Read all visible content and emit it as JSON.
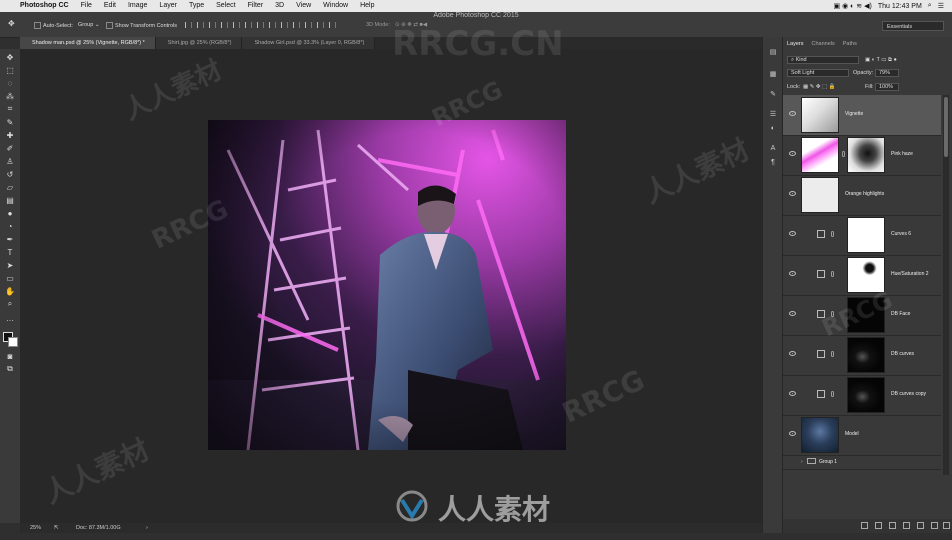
{
  "menubar": {
    "app_name": "Photoshop CC",
    "items": [
      "File",
      "Edit",
      "Image",
      "Layer",
      "Type",
      "Select",
      "Filter",
      "3D",
      "View",
      "Window",
      "Help"
    ],
    "clock": "Thu 12:43 PM"
  },
  "window_title": "Adobe Photoshop CC 2015",
  "options_bar": {
    "auto_select_label": "Auto-Select:",
    "auto_select_target": "Group",
    "show_transform_label": "Show Transform Controls",
    "mode_3d_label": "3D Mode:",
    "workspace": "Essentials"
  },
  "tabs": [
    {
      "label": "Shadow man.psd @ 25% (Vignette, RGB/8*) *",
      "active": true
    },
    {
      "label": "Shirt.jpg @ 25% (RGB/8*)",
      "active": false
    },
    {
      "label": "Shadow Girl.psd @ 33.3% (Layer 0, RGB/8*)",
      "active": false
    }
  ],
  "status": {
    "zoom": "25%",
    "doc": "Doc: 87.3M/1.00G"
  },
  "panel": {
    "tabs": [
      "Layers",
      "Channels",
      "Paths"
    ],
    "filter_kind": "Kind",
    "blend_mode": "Soft Light",
    "opacity_label": "Opacity:",
    "opacity_value": "79%",
    "lock_label": "Lock:",
    "fill_label": "Fill:",
    "fill_value": "100%"
  },
  "layers": [
    {
      "name": "Vignette",
      "thumb": "vignette",
      "selected": true
    },
    {
      "name": "Pink haze",
      "thumb": "pink",
      "selected": false
    },
    {
      "name": "Orange highlights",
      "thumb": "white-light",
      "selected": false
    },
    {
      "name": "Curves 6",
      "thumb": "white",
      "selected": false
    },
    {
      "name": "Hue/Saturation 2",
      "thumb": "white-mask",
      "selected": false
    },
    {
      "name": "DB Face",
      "thumb": "black",
      "selected": false
    },
    {
      "name": "DB curves",
      "thumb": "black-spot",
      "selected": false
    },
    {
      "name": "DB curves copy",
      "thumb": "black-spot",
      "selected": false
    },
    {
      "name": "Model",
      "thumb": "model",
      "selected": false
    },
    {
      "name": "Group 1",
      "thumb": "folder",
      "selected": false
    }
  ],
  "watermark": {
    "latin": "RRCG.CN",
    "latin_short": "RRCG",
    "cjk": "人人素材"
  },
  "colors": {
    "accent_pink": "#e040e8",
    "panel_bg": "#393939",
    "canvas_bg": "#282828"
  }
}
